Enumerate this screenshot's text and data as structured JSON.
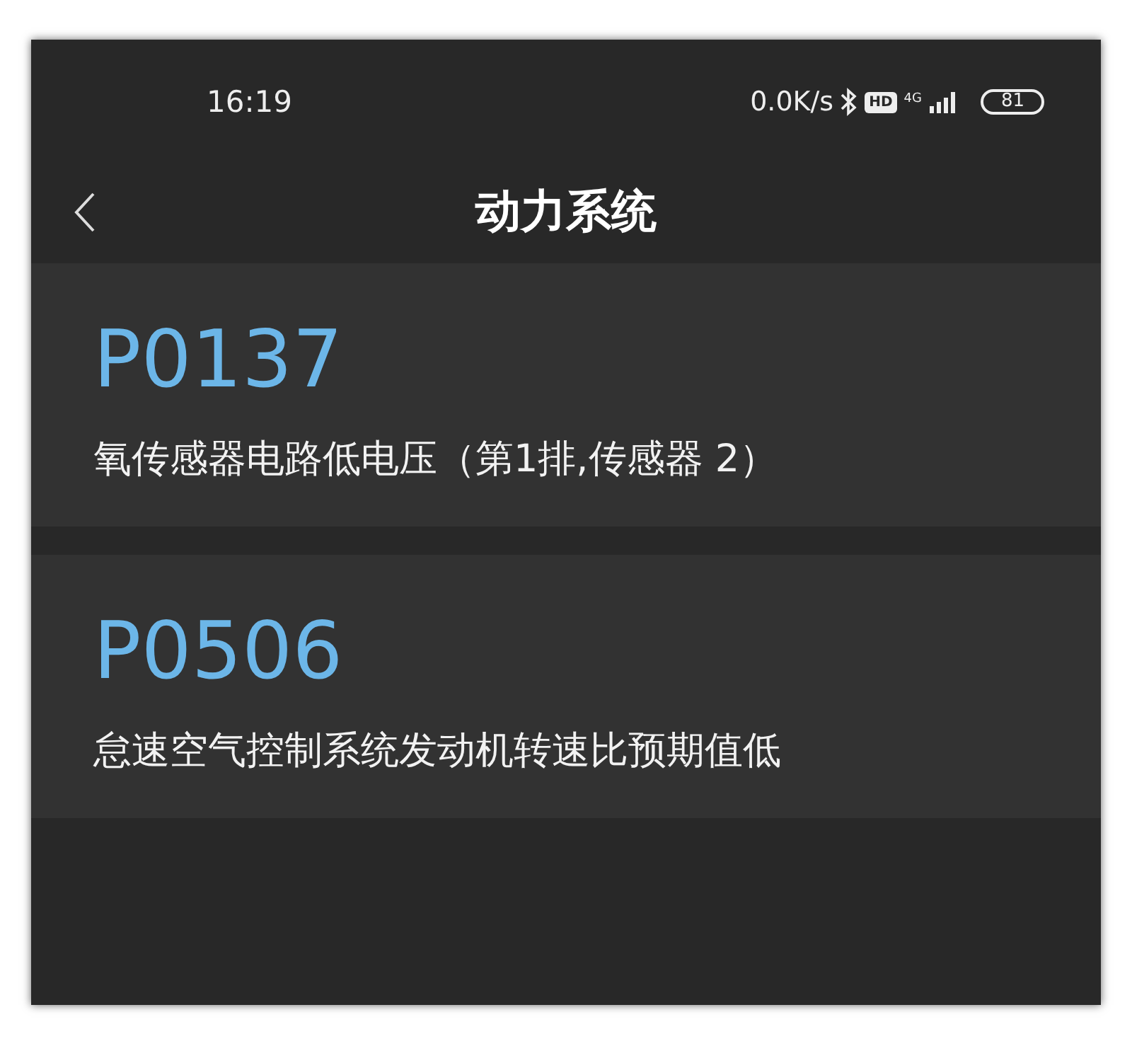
{
  "status_bar": {
    "time": "16:19",
    "net_speed": "0.0K/s",
    "hd_badge": "HD",
    "network": "4G",
    "battery": "81"
  },
  "header": {
    "title": "动力系统"
  },
  "codes": [
    {
      "code": "P0137",
      "description": "氧传感器电路低电压（第1排,传感器 2）"
    },
    {
      "code": "P0506",
      "description": "怠速空气控制系统发动机转速比预期值低"
    }
  ]
}
